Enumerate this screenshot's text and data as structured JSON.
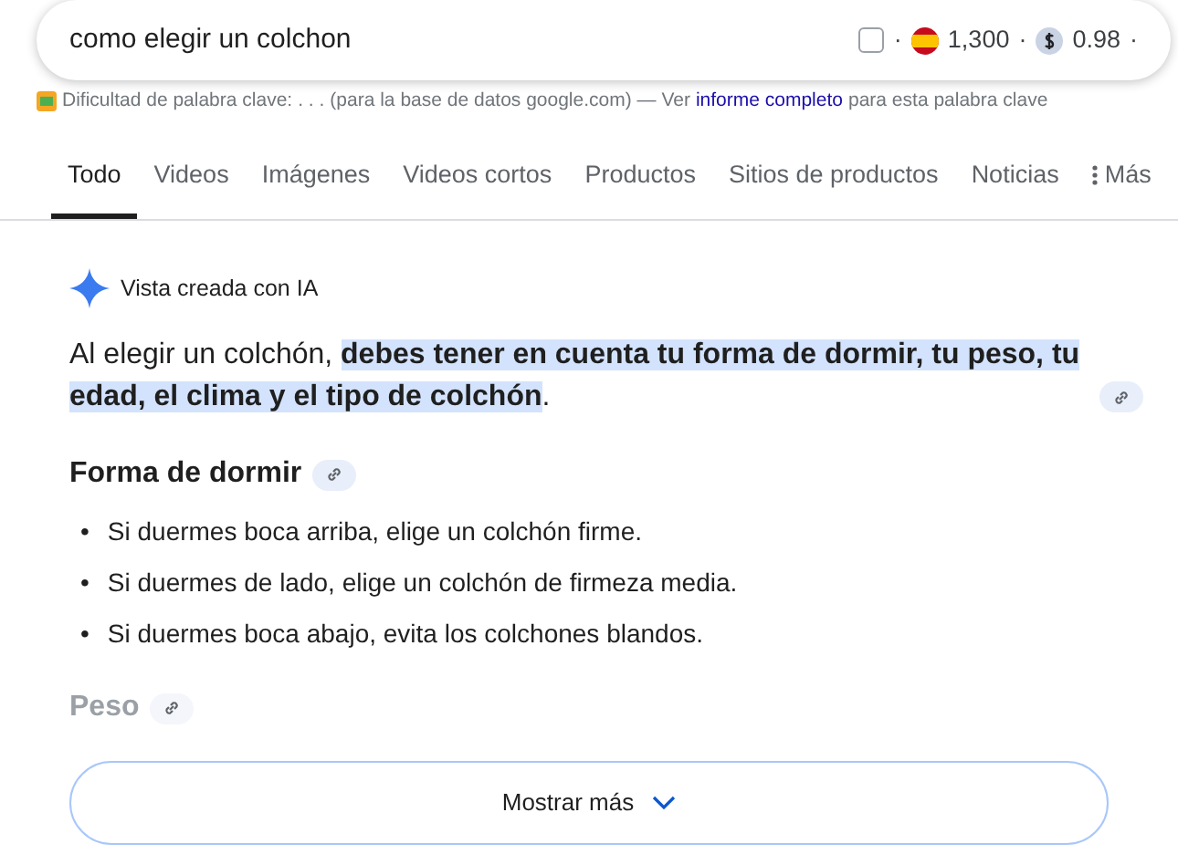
{
  "search": {
    "value": "como elegir un colchon",
    "checkbox_checked": false,
    "volume": "1,300",
    "cpc": "0.98",
    "separator": "·"
  },
  "keyword_bar": {
    "label": "Dificultad de palabra clave:",
    "difficulty": ". . .",
    "note": "(para la base de datos google.com) — Ver",
    "link": "informe completo",
    "suffix": "para esta palabra clave"
  },
  "tabs": [
    {
      "label": "Todo",
      "selected": true
    },
    {
      "label": "Videos",
      "selected": false
    },
    {
      "label": "Imágenes",
      "selected": false
    },
    {
      "label": "Videos cortos",
      "selected": false
    },
    {
      "label": "Productos",
      "selected": false
    },
    {
      "label": "Sitios de productos",
      "selected": false
    },
    {
      "label": "Noticias",
      "selected": false
    },
    {
      "label": "Más",
      "selected": false
    }
  ],
  "ai_overview": {
    "title": "Vista creada con IA",
    "summary": "Al elegir un colchón, **debes tener en cuenta tu forma de dormir, tu peso, tu edad, el clima y el tipo de colchón**.",
    "sections": [
      {
        "heading": "Forma de dormir",
        "faded": false,
        "marker": "•",
        "items": [
          "Si duermes boca arriba, elige un colchón firme.",
          "Si duermes de lado, elige un colchón de firmeza media.",
          "Si duermes boca abajo, evita los colchones blandos."
        ]
      },
      {
        "heading": "Peso",
        "faded": true
      }
    ],
    "show_more": "Mostrar más"
  }
}
